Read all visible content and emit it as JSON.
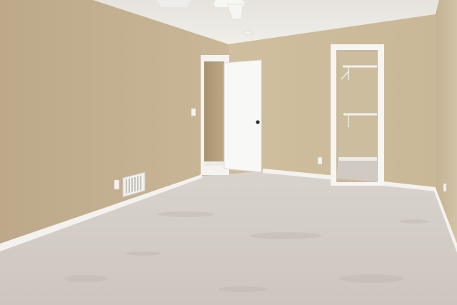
{
  "scene": {
    "subject": "empty-bedroom",
    "colors": {
      "wall_left": "#c2b092",
      "wall_back": "#cdbd9f",
      "wall_right": "#cbbb9d",
      "ceiling": "#ece9e3",
      "carpet": "#d6d0ca",
      "trim": "#f6f5f2",
      "door": "#f8f8f6",
      "closet_wall": "#c9b99c"
    },
    "icons": [
      "ceiling-fan-icon",
      "smoke-detector-icon",
      "light-switch-icon",
      "outlet-icon",
      "air-vent-icon",
      "door-knob-icon"
    ]
  }
}
